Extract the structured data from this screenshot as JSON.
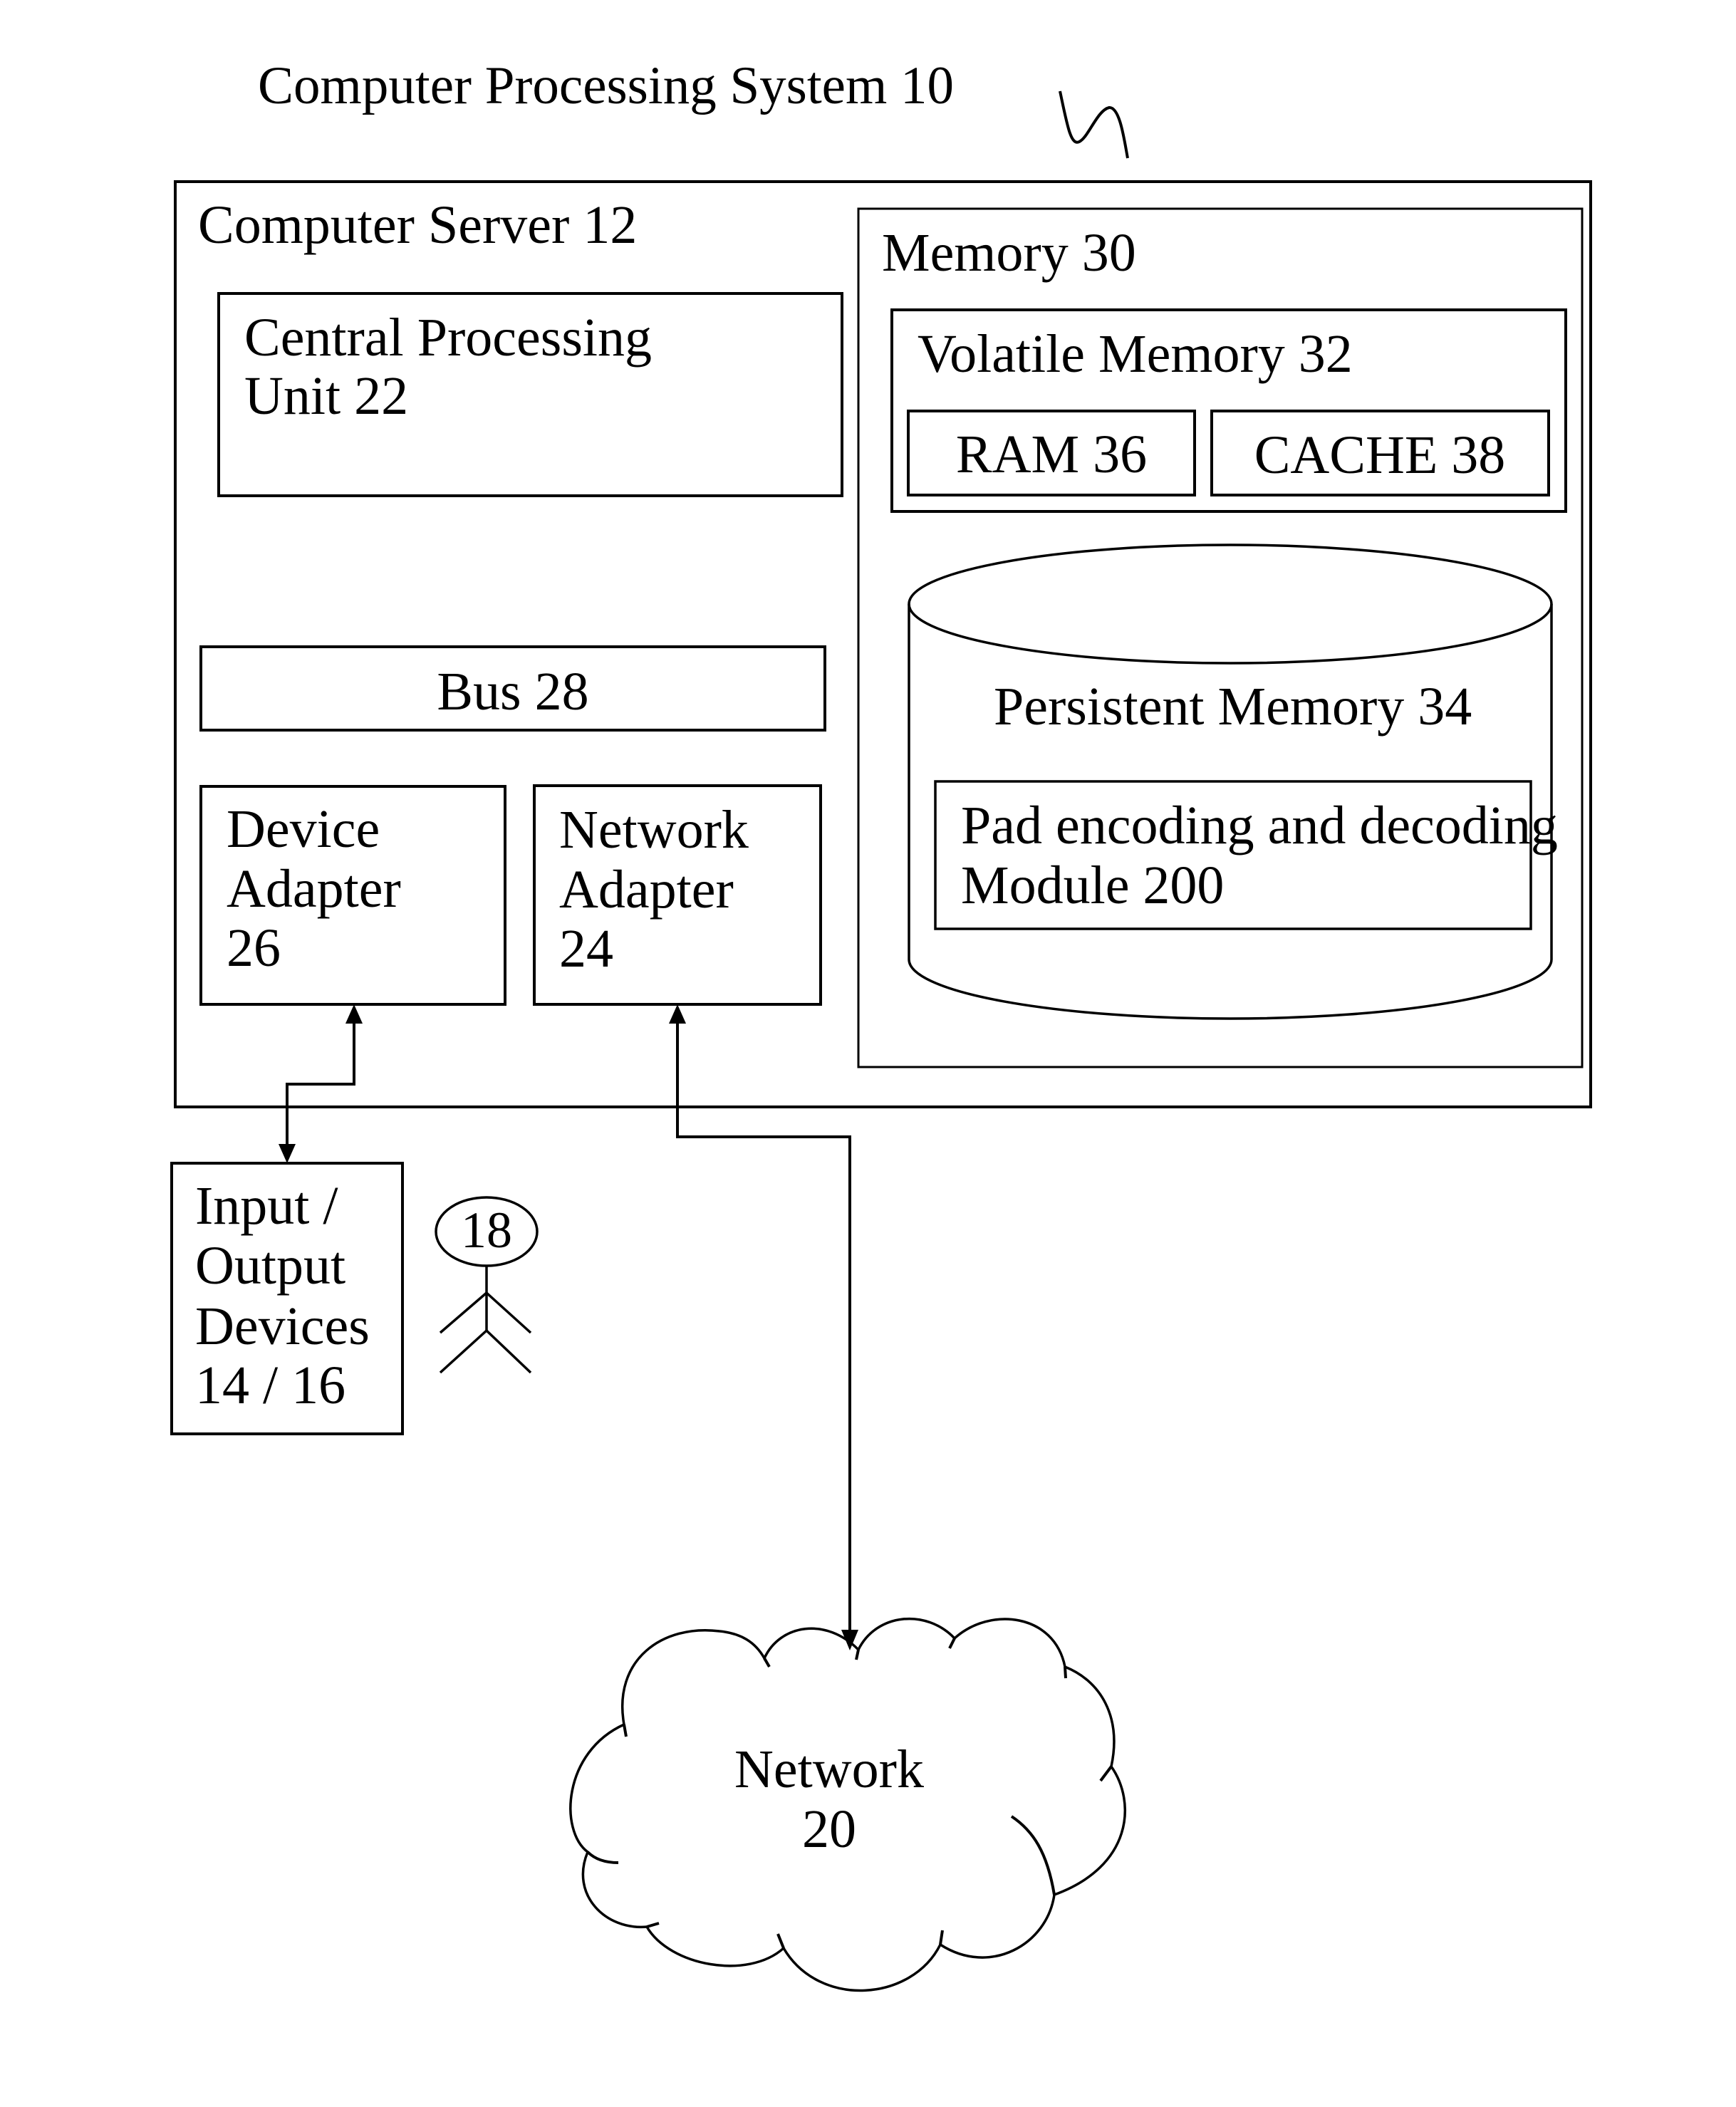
{
  "diagram": {
    "title": "Computer Processing System 10",
    "reference_mark": "squiggle-reference-mark",
    "stroke_color": "#000000",
    "background_color": "#ffffff",
    "server": {
      "label": "Computer Server 12",
      "cpu": {
        "line1": "Central Processing",
        "line2": "Unit 22"
      },
      "bus": {
        "label": "Bus 28"
      },
      "device_adapter": {
        "line1": "Device",
        "line2": "Adapter",
        "line3": "26"
      },
      "network_adapter": {
        "line1": "Network",
        "line2": "Adapter",
        "line3": "24"
      },
      "memory": {
        "label": "Memory 30",
        "volatile": {
          "label": "Volatile Memory 32",
          "ram": "RAM 36",
          "cache": "CACHE 38"
        },
        "persistent": {
          "label": "Persistent Memory 34",
          "module": {
            "line1": "Pad encoding and decoding",
            "line2": "Module 200"
          }
        }
      }
    },
    "io_devices": {
      "line1": "Input /",
      "line2": "Output",
      "line3": "Devices",
      "line4": "14 / 16"
    },
    "user": {
      "label": "18"
    },
    "network": {
      "line1": "Network",
      "line2": "20"
    },
    "connections": [
      {
        "from": "Device Adapter 26",
        "to": "Input / Output Devices 14 / 16",
        "type": "bidirectional"
      },
      {
        "from": "Network Adapter 24",
        "to": "Network 20",
        "type": "bidirectional"
      }
    ]
  }
}
